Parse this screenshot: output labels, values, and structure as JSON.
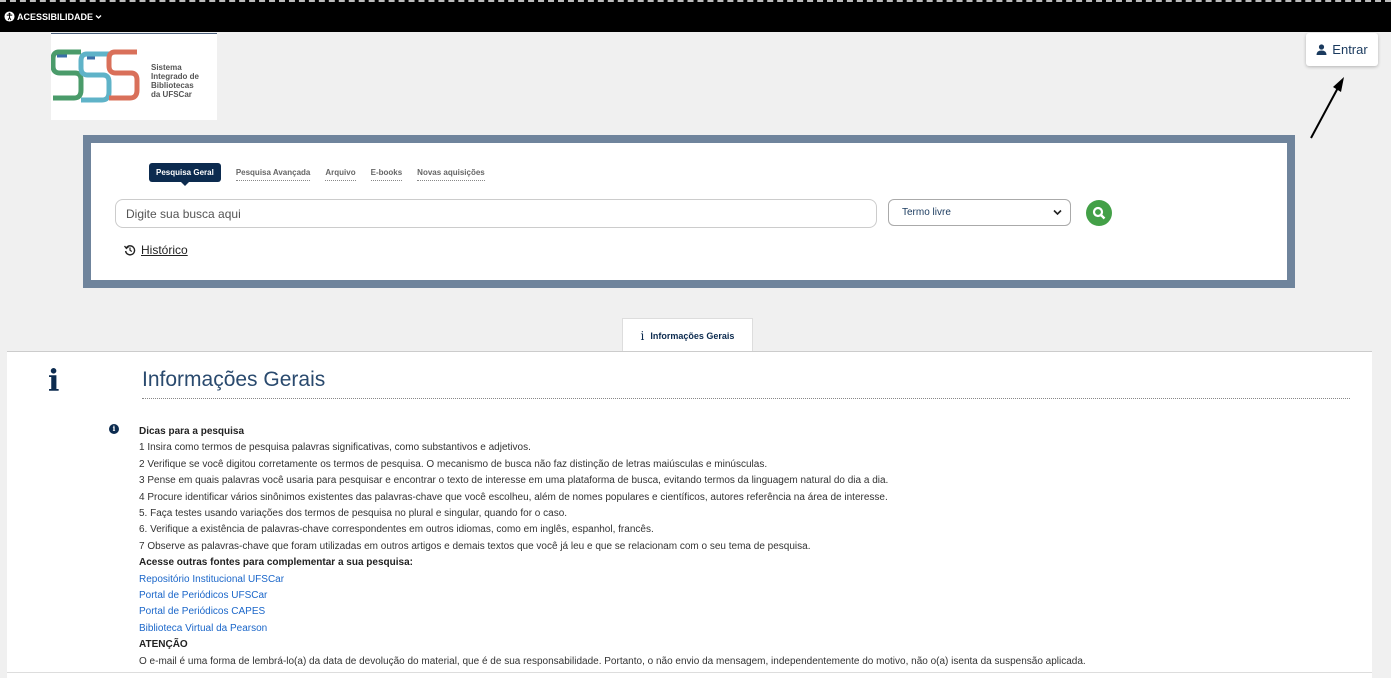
{
  "topbar": {
    "accessibility_label": "ACESSIBILIDADE"
  },
  "logo": {
    "lines": [
      "Sistema",
      "Integrado de",
      "Bibliotecas",
      "da UFSCar"
    ]
  },
  "login": {
    "label": "Entrar"
  },
  "search": {
    "tabs": [
      "Pesquisa Geral",
      "Pesquisa Avançada",
      "Arquivo",
      "E-books",
      "Novas aquisições"
    ],
    "active_tab": "Pesquisa Geral",
    "placeholder": "Digite sua busca aqui",
    "field_select": "Termo livre",
    "history_label": "Histórico"
  },
  "info_tab": {
    "label": "Informações Gerais"
  },
  "info": {
    "title": "Informações Gerais",
    "tips_heading": "Dicas para a pesquisa",
    "tips": [
      "1  Insira como termos de pesquisa palavras significativas, como substantivos e adjetivos.",
      "2 Verifique se você digitou corretamente os termos de pesquisa. O mecanismo de busca não faz distinção de letras maiúsculas e minúsculas.",
      "3 Pense em quais palavras você usaria para pesquisar e encontrar o texto de interesse em uma plataforma de busca, evitando termos da linguagem natural do dia a dia.",
      "4 Procure identificar vários sinônimos existentes das palavras-chave que você escolheu, além de nomes populares e científicos, autores referência na área de interesse.",
      "5. Faça testes usando variações dos termos de pesquisa no plural e singular, quando for o caso.",
      "6. Verifique a existência de palavras-chave correspondentes em outros idiomas, como em inglês, espanhol, francês.",
      "7 Observe as palavras-chave que foram utilizadas em outros artigos e demais textos que você já leu e que se relacionam com o seu tema de pesquisa."
    ],
    "sources_heading": "Acesse outras fontes para complementar a sua pesquisa:",
    "links": [
      "Repositório Institucional UFSCar",
      "Portal de Periódicos UFSCar",
      "Portal de Periódicos CAPES",
      "Biblioteca Virtual da Pearson"
    ],
    "attention_heading": "ATENÇÃO",
    "attention_text": "O e-mail é uma forma de lembrá-lo(a) da data de devolução do material, que é de sua responsabilidade. Portanto, o não envio da mensagem, independentemente do motivo, não o(a) isenta da suspensão aplicada."
  },
  "colors": {
    "navy": "#0c2b4f",
    "panel_border": "#6f849c",
    "search_button": "#43a047",
    "link": "#1a66c9"
  },
  "icons": [
    "accessibility-icon",
    "chevron-down-icon",
    "user-icon",
    "search-icon",
    "history-icon",
    "info-icon",
    "info-circle-icon",
    "arrow-annotation-icon"
  ]
}
